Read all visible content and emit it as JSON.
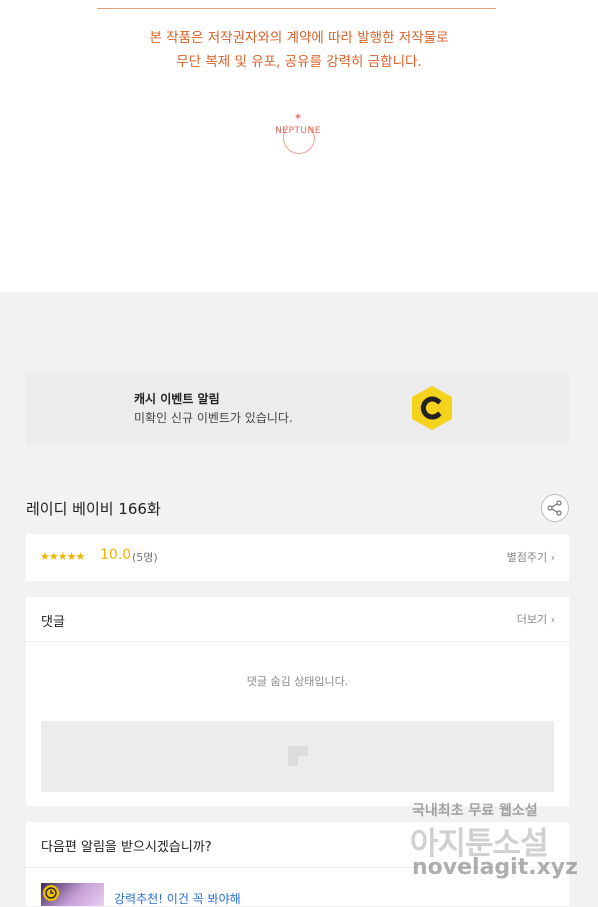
{
  "viewer": {
    "copyright_line1": "본 작품은 저작권자와의 계약에 따라 발행한 저작물로",
    "copyright_line2": "무단 복제 및 유포, 공유를 강력히 금합니다.",
    "publisher_logo": "NEPTUNE"
  },
  "cash_event": {
    "title": "캐시 이벤트 알림",
    "subtitle": "미확인 신규 이벤트가 있습니다.",
    "icon": "c-coin-icon",
    "accent_color": "#f5d21b"
  },
  "episode": {
    "title": "레이디 베이비 166화",
    "share_icon": "share-icon"
  },
  "rating": {
    "stars": "★★★★★",
    "score": "10.0",
    "count": "(5명)",
    "rate_link": "별점주기",
    "star_color": "#f0b400"
  },
  "comments": {
    "title": "댓글",
    "more_link": "더보기",
    "hidden_message": "댓글 숨김 상태입니다."
  },
  "next_episode": {
    "title": "다음편 알림을 받으시겠습니까?",
    "recommendation": "강력추천! 이건 꼭 봐야해"
  },
  "watermark": {
    "line1": "국내최초 무료 웹소설",
    "line2": "아지툰소설",
    "line3": "novelagit.xyz"
  }
}
